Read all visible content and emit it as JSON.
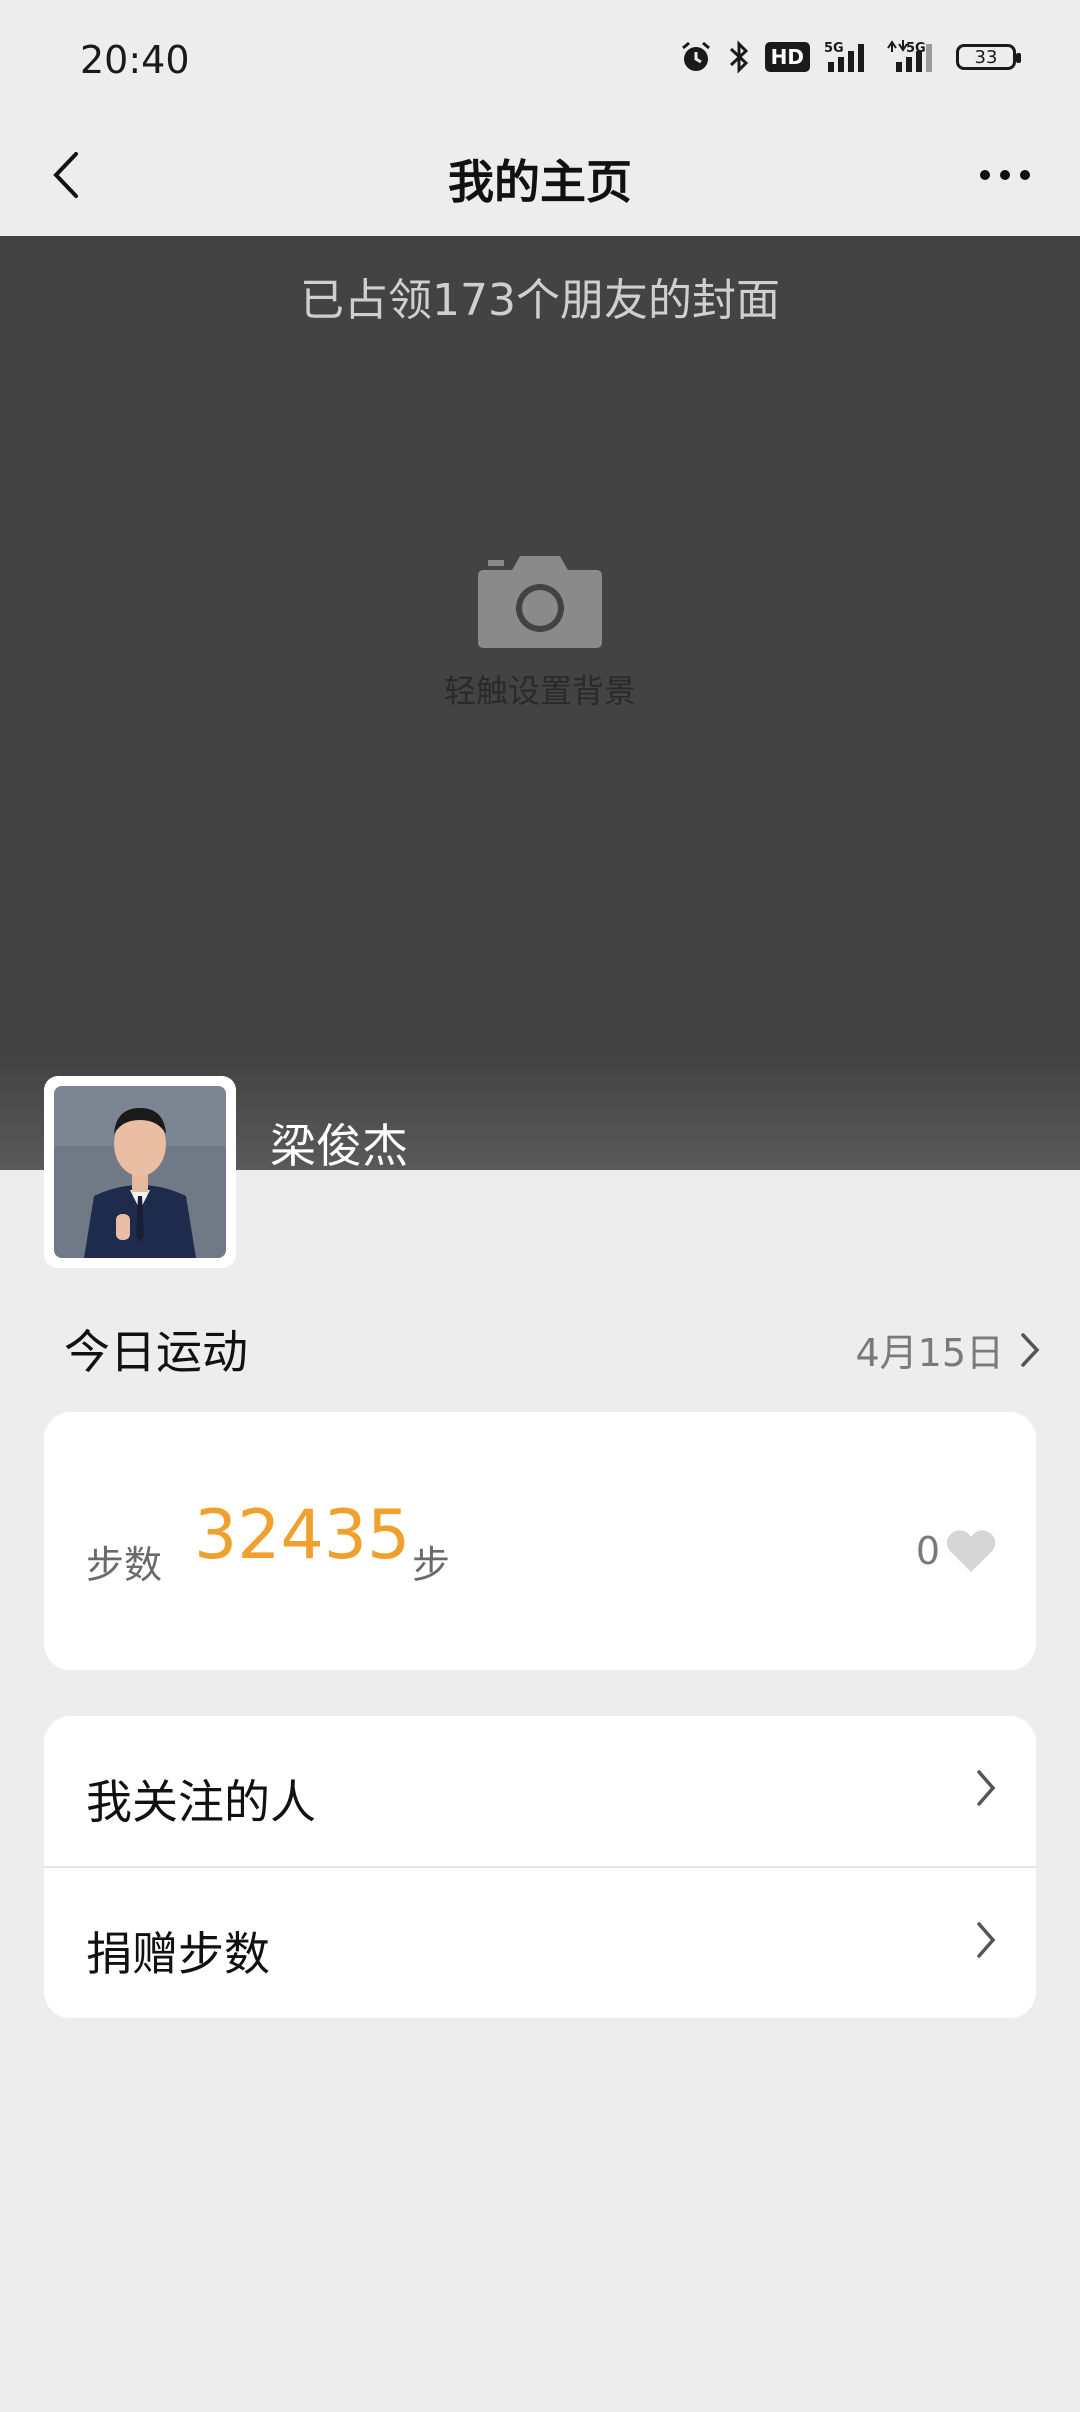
{
  "status_bar": {
    "time": "20:40",
    "hd_label": "HD",
    "signal1_label": "5G",
    "signal2_label": "5G",
    "battery_level": "33"
  },
  "nav": {
    "title": "我的主页"
  },
  "cover": {
    "caption": "已占领173个朋友的封面",
    "set_background_label": "轻触设置背景"
  },
  "profile": {
    "name": "梁俊杰"
  },
  "today_sports": {
    "title": "今日运动",
    "date": "4月15日",
    "steps_label": "步数",
    "steps_value": "32435",
    "steps_unit": "步",
    "likes": "0"
  },
  "menu": {
    "items": [
      {
        "label": "我关注的人"
      },
      {
        "label": "捐赠步数"
      }
    ]
  },
  "colors": {
    "accent_orange": "#f0a02c",
    "cover_gray": "#434343",
    "page_bg": "#ededed"
  }
}
